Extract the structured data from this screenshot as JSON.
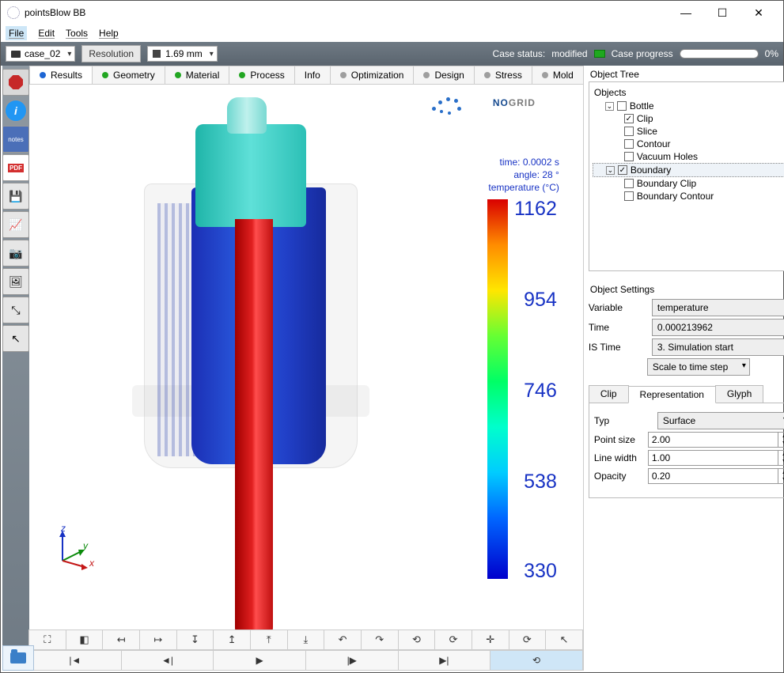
{
  "window": {
    "title": "pointsBlow BB"
  },
  "menu": {
    "file": "File",
    "edit": "Edit",
    "tools": "Tools",
    "help": "Help"
  },
  "toolbar": {
    "case": "case_02",
    "resolution_label": "Resolution",
    "resolution_value": "1.69 mm",
    "case_status_label": "Case status:",
    "case_status_value": "modified",
    "case_progress_label": "Case progress",
    "case_progress_value": "0%"
  },
  "tabs": {
    "results": "Results",
    "geometry": "Geometry",
    "material": "Material",
    "process": "Process",
    "info": "Info",
    "optimization": "Optimization",
    "design": "Design",
    "stress": "Stress",
    "mold": "Mold"
  },
  "viz": {
    "logo_no": "NO",
    "logo_grid": "GRID",
    "time_line": "time: 0.0002 s",
    "angle_line": "angle: 28 °",
    "temp_line": "temperature (°C)",
    "ticks": [
      "1162",
      "954",
      "746",
      "538",
      "330"
    ],
    "axes": {
      "x": "x",
      "y": "y",
      "z": "z"
    }
  },
  "chart_data": {
    "type": "colorbar",
    "title": "temperature (°C)",
    "range": [
      330,
      1162
    ],
    "ticks": [
      1162,
      954,
      746,
      538,
      330
    ],
    "colormap": "rainbow (blue low → red high)",
    "annotations": {
      "time_s": 0.0002,
      "angle_deg": 28
    }
  },
  "tree": {
    "title": "Object Tree",
    "root": "Objects",
    "bottle": {
      "label": "Bottle",
      "checked": false,
      "clip": {
        "label": "Clip",
        "checked": true
      },
      "slice": {
        "label": "Slice",
        "checked": false
      },
      "contour": {
        "label": "Contour",
        "checked": false
      },
      "vacuum": {
        "label": "Vacuum Holes",
        "checked": false
      }
    },
    "boundary": {
      "label": "Boundary",
      "checked": true,
      "bclip": {
        "label": "Boundary Clip",
        "checked": false
      },
      "bcontour": {
        "label": "Boundary Contour",
        "checked": false
      }
    }
  },
  "settings": {
    "title": "Object Settings",
    "variable_label": "Variable",
    "variable": "temperature",
    "time_label": "Time",
    "time": "0.000213962",
    "istime_label": "IS Time",
    "istime": "3. Simulation start",
    "scale": "Scale to time step"
  },
  "subtabs": {
    "clip": "Clip",
    "rep": "Representation",
    "glyph": "Glyph"
  },
  "rep": {
    "typ_label": "Typ",
    "typ": "Surface",
    "psize_label": "Point size",
    "psize": "2.00",
    "lwidth_label": "Line width",
    "lwidth": "1.00",
    "opacity_label": "Opacity",
    "opacity": "0.20"
  }
}
